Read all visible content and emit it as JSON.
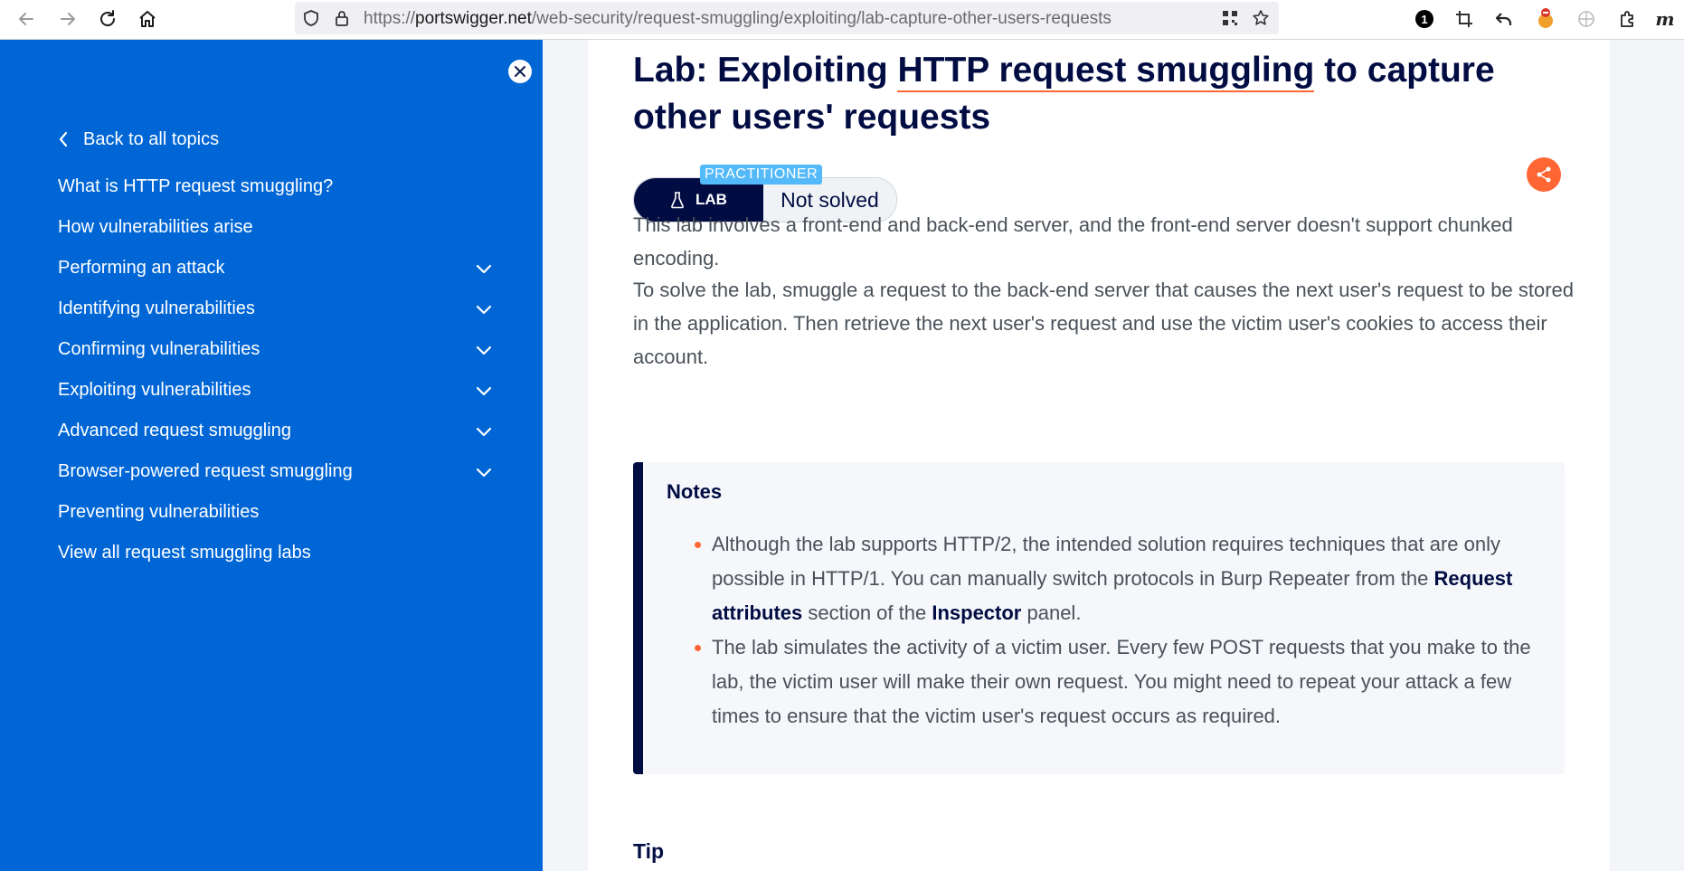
{
  "browser": {
    "url_scheme": "https://",
    "url_host": "portswigger.net",
    "url_path": "/web-security/request-smuggling/exploiting/lab-capture-other-users-requests",
    "extension_badge_count": "1",
    "extension_letter": "m"
  },
  "sidebar": {
    "back_label": "Back to all topics",
    "items": [
      {
        "label": "What is HTTP request smuggling?",
        "expandable": false
      },
      {
        "label": "How vulnerabilities arise",
        "expandable": false
      },
      {
        "label": "Performing an attack",
        "expandable": true
      },
      {
        "label": "Identifying vulnerabilities",
        "expandable": true
      },
      {
        "label": "Confirming vulnerabilities",
        "expandable": true
      },
      {
        "label": "Exploiting vulnerabilities",
        "expandable": true
      },
      {
        "label": "Advanced request smuggling",
        "expandable": true
      },
      {
        "label": "Browser-powered request smuggling",
        "expandable": true
      },
      {
        "label": "Preventing vulnerabilities",
        "expandable": false
      },
      {
        "label": "View all request smuggling labs",
        "expandable": false
      }
    ]
  },
  "main": {
    "title_prefix": "Lab: Exploiting ",
    "title_highlight": "HTTP request smuggling",
    "title_suffix": " to capture other users' requests",
    "level": "PRACTITIONER",
    "lab_label": "LAB",
    "status": "Not solved",
    "para1": "This lab involves a front-end and back-end server, and the front-end server doesn't support chunked encoding.",
    "para2": "To solve the lab, smuggle a request to the back-end server that causes the next user's request to be stored in the application. Then retrieve the next user's request and use the victim user's cookies to access their account.",
    "notes": {
      "heading": "Notes",
      "item1": {
        "t1": "Although the lab supports HTTP/2, the intended solution requires techniques that are only possible in HTTP/1. You can manually switch protocols in Burp Repeater from the ",
        "b1": "Request attributes",
        "t2": " section of the ",
        "b2": "Inspector",
        "t3": " panel."
      },
      "item2": "The lab simulates the activity of a victim user. Every few POST requests that you make to the lab, the victim user will make their own request. You might need to repeat your attack a few times to ensure that the victim user's request occurs as required."
    },
    "tip_heading": "Tip"
  },
  "colors": {
    "sidebar_bg": "#0066d6",
    "heading": "#010c43",
    "accent": "#ff6633",
    "practitioner": "#54b9f9"
  }
}
